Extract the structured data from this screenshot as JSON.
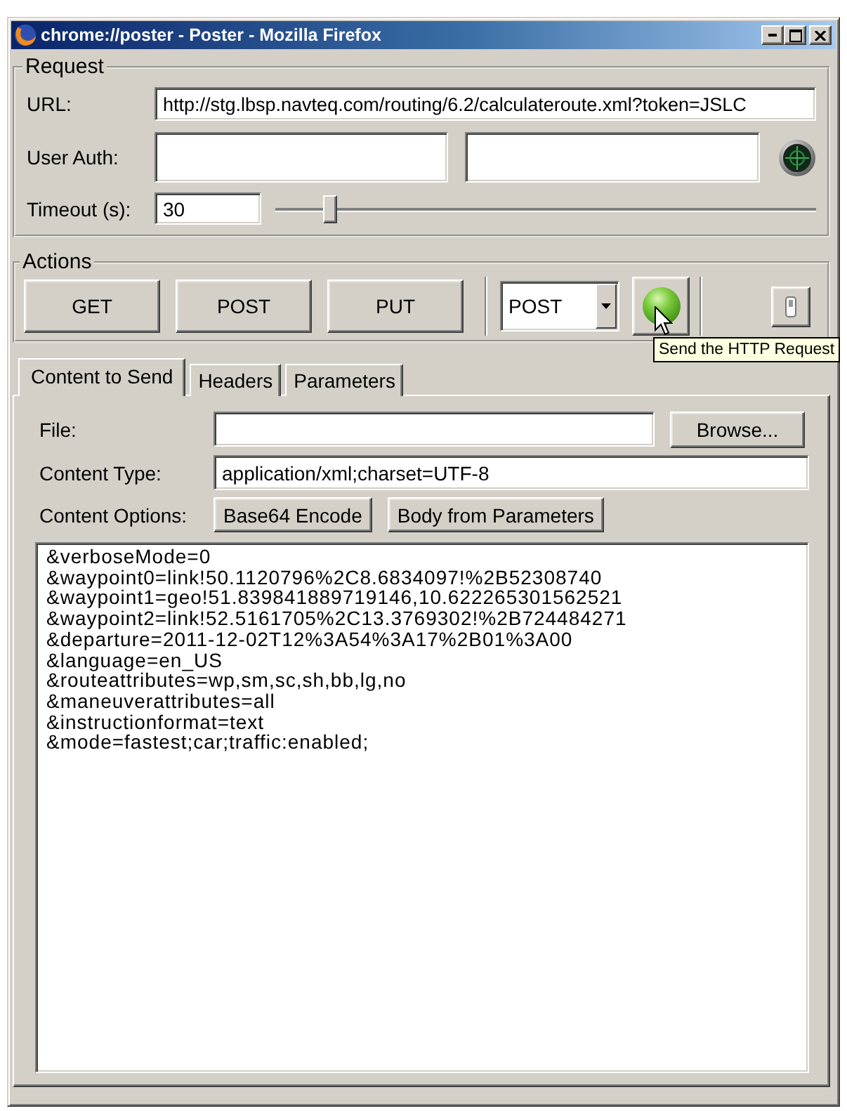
{
  "window": {
    "title": "chrome://poster - Poster - Mozilla Firefox"
  },
  "request": {
    "legend": "Request",
    "url": {
      "label": "URL:",
      "value": "http://stg.lbsp.navteq.com/routing/6.2/calculateroute.xml?token=JSLC"
    },
    "user_auth": {
      "label": "User Auth:"
    },
    "timeout": {
      "label": "Timeout (s):",
      "value": "30",
      "level": 0.1
    }
  },
  "actions": {
    "legend": "Actions",
    "buttons": [
      "GET",
      "POST",
      "PUT"
    ],
    "method_select": {
      "value": "POST"
    },
    "send_tooltip": "Send the HTTP Request"
  },
  "tabs": [
    {
      "label": "Content to Send",
      "selected": true
    },
    {
      "label": "Headers",
      "selected": false
    },
    {
      "label": "Parameters",
      "selected": false
    }
  ],
  "content": {
    "file": {
      "label": "File:",
      "button": "Browse..."
    },
    "content_type": {
      "label": "Content Type:",
      "value": "application/xml;charset=UTF-8"
    },
    "content_options": {
      "label": "Content Options:",
      "buttons": [
        "Base64 Encode",
        "Body from Parameters"
      ]
    },
    "body_lines": [
      "&verboseMode=0",
      "&waypoint0=link!50.1120796%2C8.6834097!%2B52308740",
      "&waypoint1=geo!51.839841889719146,10.622265301562521",
      "&waypoint2=link!52.5161705%2C13.3769302!%2B724484271",
      "&departure=2011-12-02T12%3A54%3A17%2B01%3A00",
      "&language=en_US",
      "&routeattributes=wp,sm,sc,sh,bb,lg,no",
      "&maneuverattributes=all",
      "&instructionformat=text",
      "&mode=fastest;car;traffic:enabled;"
    ]
  }
}
